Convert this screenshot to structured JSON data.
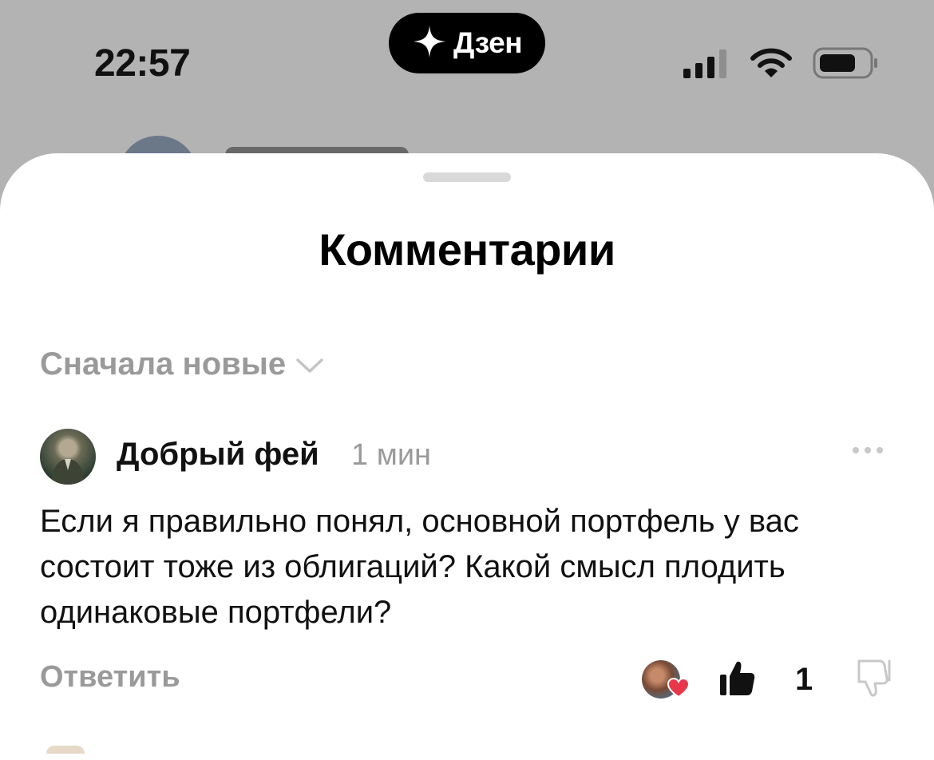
{
  "status_bar": {
    "time": "22:57",
    "island_label": "Дзен"
  },
  "sheet": {
    "title": "Комментарии",
    "sort_label": "Сначала новые"
  },
  "comment": {
    "author": "Добрый фей",
    "time_ago": "1 мин",
    "text": "Если я правильно понял, основной портфель у вас состоит тоже из облигаций? Какой смысл плодить одинаковые портфели?",
    "reply_label": "Ответить",
    "like_count": "1"
  },
  "colors": {
    "muted": "#9a9a9a",
    "heart": "#e8374b"
  }
}
